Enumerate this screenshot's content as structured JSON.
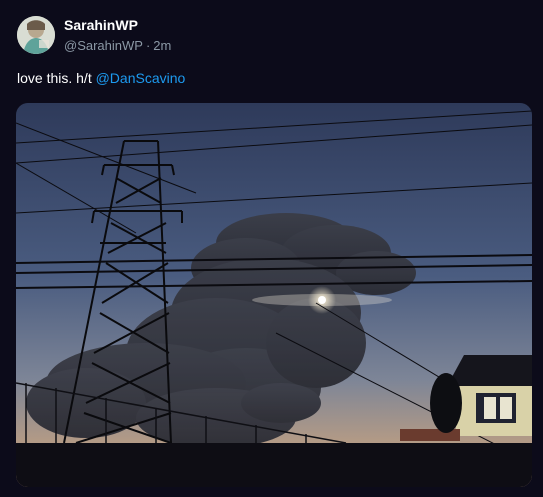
{
  "tweet": {
    "display_name": "SarahinWP",
    "handle": "@SarahinWP",
    "separator": "·",
    "time": "2m",
    "text_prefix": "love this. h/t ",
    "mention": "@DanScavino",
    "media": {
      "icon": "photo"
    }
  },
  "colors": {
    "background": "#0c0b1a",
    "text": "#ffffff",
    "secondary_text": "#8b98a5",
    "link": "#1d9bf0"
  }
}
